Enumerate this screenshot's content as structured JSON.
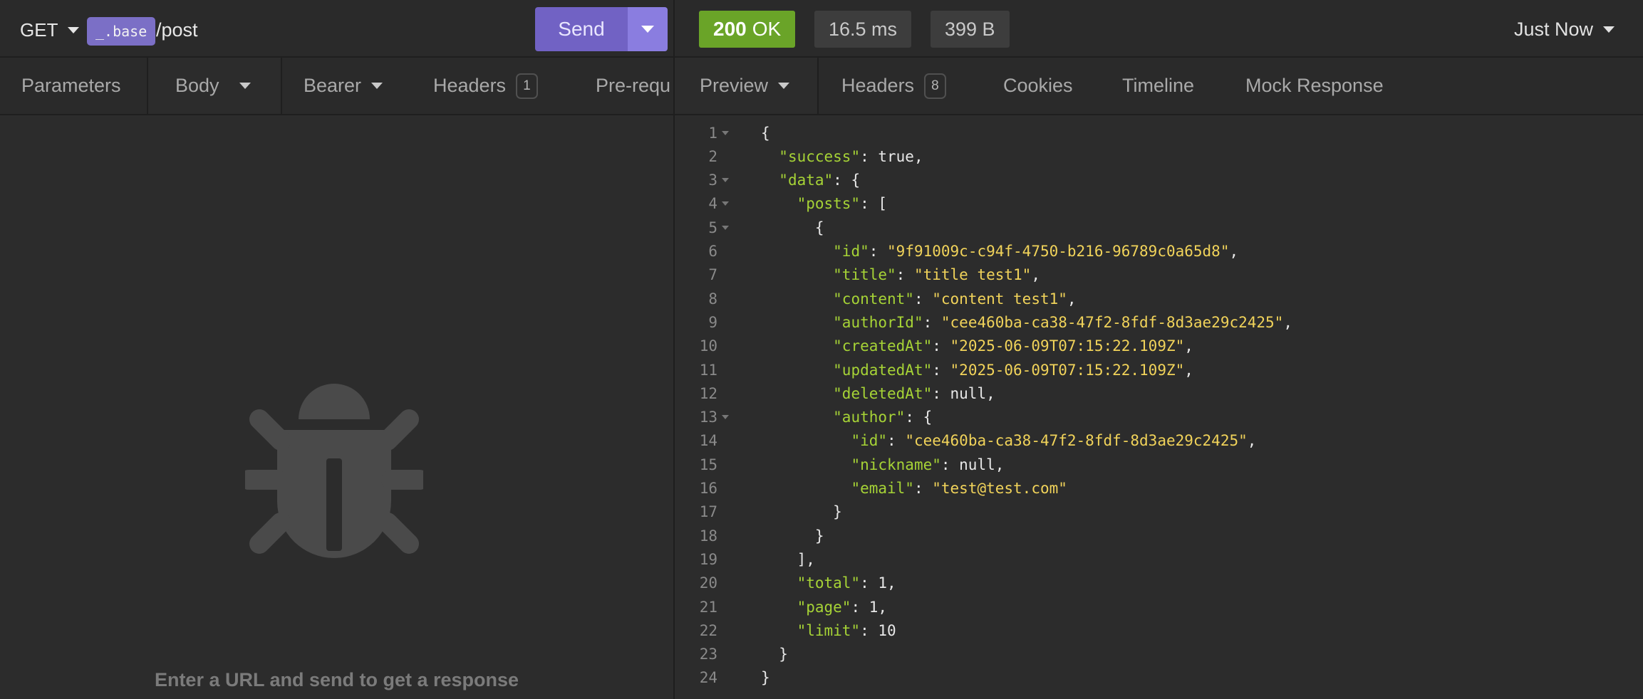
{
  "request": {
    "method": "GET",
    "env_tag": "_.base",
    "path": "/post",
    "send_label": "Send",
    "tabs": [
      {
        "label": "Parameters"
      },
      {
        "label": "Body"
      },
      {
        "label": "Bearer"
      },
      {
        "label": "Headers",
        "badge": "1"
      },
      {
        "label": "Pre-requ"
      }
    ],
    "empty_hint": "Enter a URL and send to get a response"
  },
  "response": {
    "status_code": "200",
    "status_text": "OK",
    "time": "16.5 ms",
    "size": "399 B",
    "history": "Just Now",
    "tabs": [
      {
        "label": "Preview"
      },
      {
        "label": "Headers",
        "badge": "8"
      },
      {
        "label": "Cookies"
      },
      {
        "label": "Timeline"
      },
      {
        "label": "Mock Response"
      }
    ],
    "lines": [
      {
        "n": "1",
        "fold": true,
        "parts": [
          [
            "p",
            "{"
          ]
        ]
      },
      {
        "n": "2",
        "fold": false,
        "parts": [
          [
            "p",
            "  "
          ],
          [
            "k",
            "\"success\""
          ],
          [
            "p",
            ": true,"
          ]
        ]
      },
      {
        "n": "3",
        "fold": true,
        "parts": [
          [
            "p",
            "  "
          ],
          [
            "k",
            "\"data\""
          ],
          [
            "p",
            ": {"
          ]
        ]
      },
      {
        "n": "4",
        "fold": true,
        "parts": [
          [
            "p",
            "    "
          ],
          [
            "k",
            "\"posts\""
          ],
          [
            "p",
            ": ["
          ]
        ]
      },
      {
        "n": "5",
        "fold": true,
        "parts": [
          [
            "p",
            "      {"
          ]
        ]
      },
      {
        "n": "6",
        "fold": false,
        "parts": [
          [
            "p",
            "        "
          ],
          [
            "k",
            "\"id\""
          ],
          [
            "p",
            ": "
          ],
          [
            "s",
            "\"9f91009c-c94f-4750-b216-96789c0a65d8\""
          ],
          [
            "p",
            ","
          ]
        ]
      },
      {
        "n": "7",
        "fold": false,
        "parts": [
          [
            "p",
            "        "
          ],
          [
            "k",
            "\"title\""
          ],
          [
            "p",
            ": "
          ],
          [
            "s",
            "\"title test1\""
          ],
          [
            "p",
            ","
          ]
        ]
      },
      {
        "n": "8",
        "fold": false,
        "parts": [
          [
            "p",
            "        "
          ],
          [
            "k",
            "\"content\""
          ],
          [
            "p",
            ": "
          ],
          [
            "s",
            "\"content test1\""
          ],
          [
            "p",
            ","
          ]
        ]
      },
      {
        "n": "9",
        "fold": false,
        "parts": [
          [
            "p",
            "        "
          ],
          [
            "k",
            "\"authorId\""
          ],
          [
            "p",
            ": "
          ],
          [
            "s",
            "\"cee460ba-ca38-47f2-8fdf-8d3ae29c2425\""
          ],
          [
            "p",
            ","
          ]
        ]
      },
      {
        "n": "10",
        "fold": false,
        "parts": [
          [
            "p",
            "        "
          ],
          [
            "k",
            "\"createdAt\""
          ],
          [
            "p",
            ": "
          ],
          [
            "s",
            "\"2025-06-09T07:15:22.109Z\""
          ],
          [
            "p",
            ","
          ]
        ]
      },
      {
        "n": "11",
        "fold": false,
        "parts": [
          [
            "p",
            "        "
          ],
          [
            "k",
            "\"updatedAt\""
          ],
          [
            "p",
            ": "
          ],
          [
            "s",
            "\"2025-06-09T07:15:22.109Z\""
          ],
          [
            "p",
            ","
          ]
        ]
      },
      {
        "n": "12",
        "fold": false,
        "parts": [
          [
            "p",
            "        "
          ],
          [
            "k",
            "\"deletedAt\""
          ],
          [
            "p",
            ": null,"
          ]
        ]
      },
      {
        "n": "13",
        "fold": true,
        "parts": [
          [
            "p",
            "        "
          ],
          [
            "k",
            "\"author\""
          ],
          [
            "p",
            ": {"
          ]
        ]
      },
      {
        "n": "14",
        "fold": false,
        "parts": [
          [
            "p",
            "          "
          ],
          [
            "k",
            "\"id\""
          ],
          [
            "p",
            ": "
          ],
          [
            "s",
            "\"cee460ba-ca38-47f2-8fdf-8d3ae29c2425\""
          ],
          [
            "p",
            ","
          ]
        ]
      },
      {
        "n": "15",
        "fold": false,
        "parts": [
          [
            "p",
            "          "
          ],
          [
            "k",
            "\"nickname\""
          ],
          [
            "p",
            ": null,"
          ]
        ]
      },
      {
        "n": "16",
        "fold": false,
        "parts": [
          [
            "p",
            "          "
          ],
          [
            "k",
            "\"email\""
          ],
          [
            "p",
            ": "
          ],
          [
            "s",
            "\"test@test.com\""
          ]
        ]
      },
      {
        "n": "17",
        "fold": false,
        "parts": [
          [
            "p",
            "        }"
          ]
        ]
      },
      {
        "n": "18",
        "fold": false,
        "parts": [
          [
            "p",
            "      }"
          ]
        ]
      },
      {
        "n": "19",
        "fold": false,
        "parts": [
          [
            "p",
            "    ],"
          ]
        ]
      },
      {
        "n": "20",
        "fold": false,
        "parts": [
          [
            "p",
            "    "
          ],
          [
            "k",
            "\"total\""
          ],
          [
            "p",
            ": 1,"
          ]
        ]
      },
      {
        "n": "21",
        "fold": false,
        "parts": [
          [
            "p",
            "    "
          ],
          [
            "k",
            "\"page\""
          ],
          [
            "p",
            ": 1,"
          ]
        ]
      },
      {
        "n": "22",
        "fold": false,
        "parts": [
          [
            "p",
            "    "
          ],
          [
            "k",
            "\"limit\""
          ],
          [
            "p",
            ": 10"
          ]
        ]
      },
      {
        "n": "23",
        "fold": false,
        "parts": [
          [
            "p",
            "  }"
          ]
        ]
      },
      {
        "n": "24",
        "fold": false,
        "parts": [
          [
            "p",
            "}"
          ]
        ]
      }
    ]
  },
  "colors": {
    "send": "#7162c4",
    "status_ok": "#6aa428",
    "json_key": "#a6d336",
    "json_string": "#f1d35a"
  }
}
